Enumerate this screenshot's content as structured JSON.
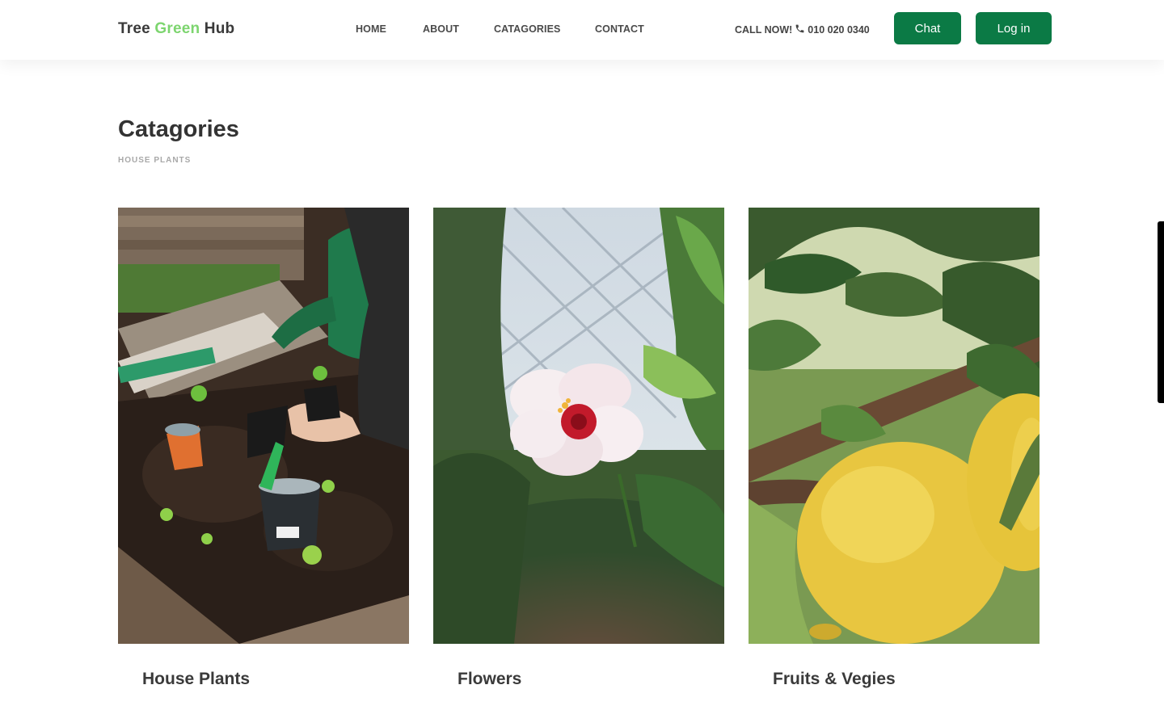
{
  "header": {
    "logo": {
      "part1": "Tree ",
      "part2": "Green",
      "part3": " Hub"
    },
    "nav": [
      {
        "label": "HOME"
      },
      {
        "label": "ABOUT"
      },
      {
        "label": "CATAGORIES"
      },
      {
        "label": "CONTACT"
      }
    ],
    "call": {
      "label": "CALL NOW!",
      "icon": "phone-icon",
      "number": "010 020 0340"
    },
    "chat_label": "Chat",
    "login_label": "Log in",
    "accent_color": "#0b7a45",
    "logo_accent_color": "#7dd56f"
  },
  "main": {
    "title": "Catagories",
    "subtitle": "HOUSE PLANTS",
    "categories": [
      {
        "label": "House Plants"
      },
      {
        "label": "Flowers"
      },
      {
        "label": "Fruits & Vegies"
      }
    ]
  }
}
